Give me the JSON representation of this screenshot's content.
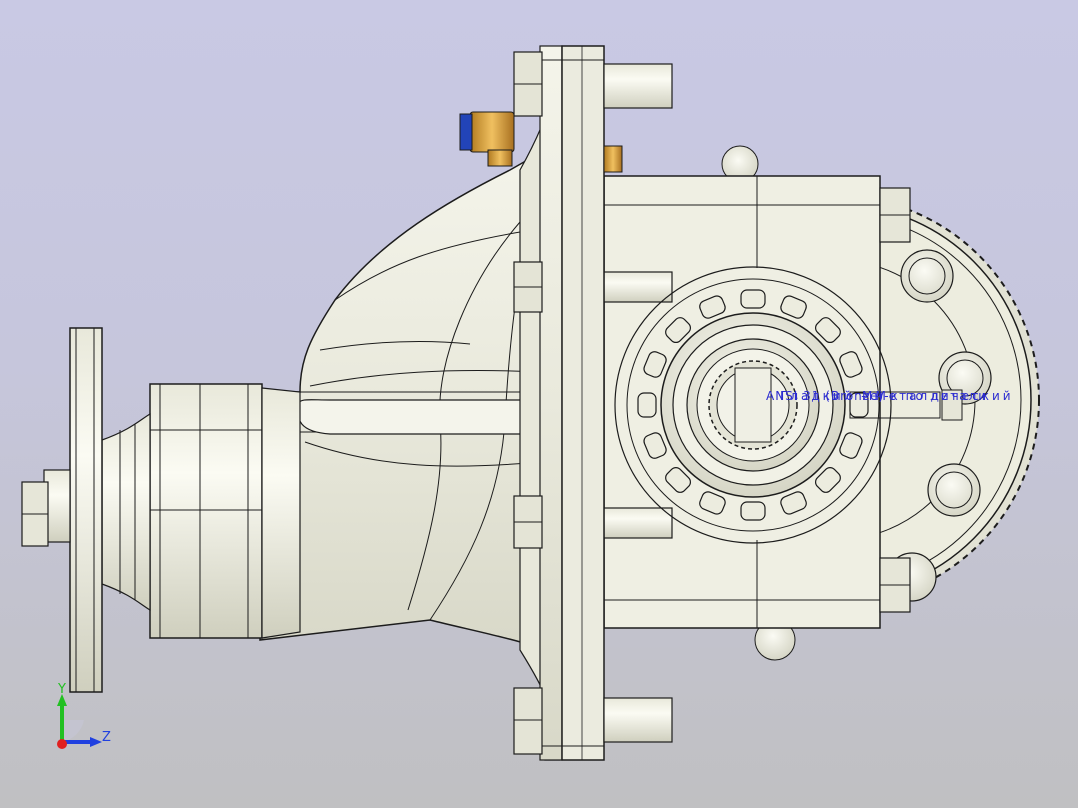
{
  "viewport": {
    "background_top": "#c9c9e4",
    "background_bottom": "#c0c0c2",
    "body_color": "#ededdf",
    "edge_color": "#1c1c1c",
    "fitting_gold": "#d9a84a",
    "fitting_blue": "#2244b8"
  },
  "annotation": {
    "color": "#2c2cd0",
    "line_a": "ANSI 31 (Bronze)",
    "line_b": "Гладкий - Металлический",
    "line_c": "Мн-к по детали"
  },
  "triad": {
    "x_label": "",
    "y_label": "Y",
    "z_label": "Z",
    "x_color": "#e02020",
    "y_color": "#22c022",
    "z_color": "#2040e0"
  }
}
